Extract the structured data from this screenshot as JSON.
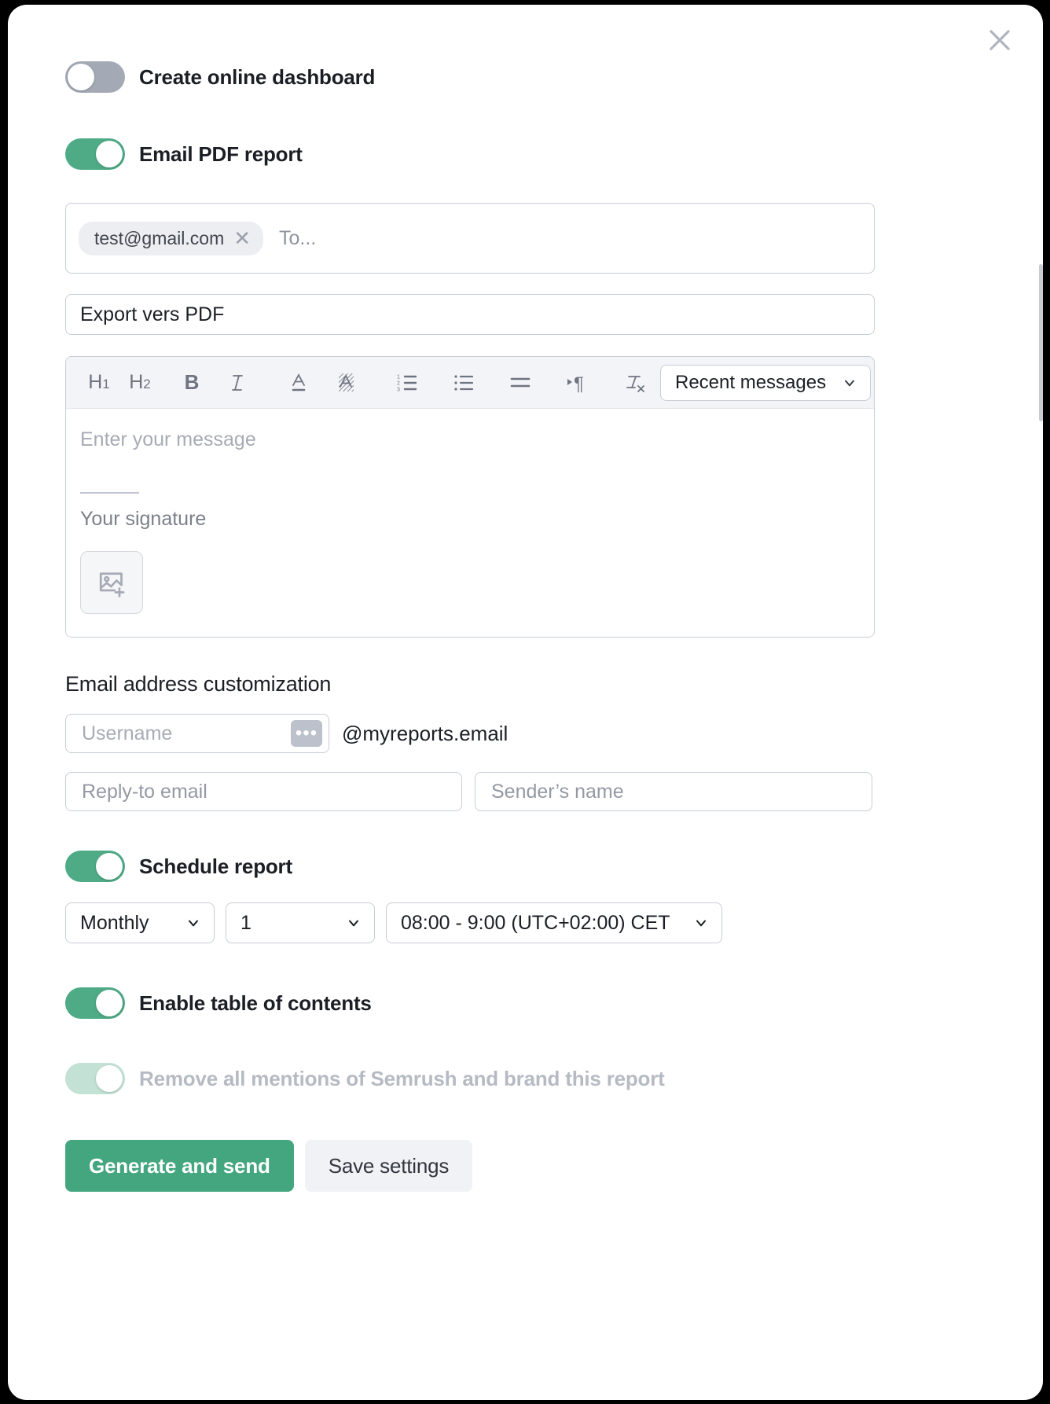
{
  "modal": {
    "close_icon": "close-icon"
  },
  "toggles": {
    "create_dashboard": {
      "label": "Create online dashboard",
      "state": "off"
    },
    "email_pdf": {
      "label": "Email PDF report",
      "state": "on"
    },
    "schedule": {
      "label": "Schedule report",
      "state": "on"
    },
    "toc": {
      "label": "Enable table of contents",
      "state": "on"
    },
    "whitelabel": {
      "label": "Remove all mentions of Semrush and brand this report",
      "state": "on-disabled"
    }
  },
  "recipients": {
    "chips": [
      {
        "email": "test@gmail.com",
        "remove_icon": "close-icon"
      }
    ],
    "placeholder": "To..."
  },
  "subject": {
    "value": "Export vers PDF"
  },
  "editor": {
    "toolbar": [
      {
        "name": "heading-1-icon",
        "glyph": "H₁"
      },
      {
        "name": "heading-2-icon",
        "glyph": "H₂"
      },
      {
        "name": "bold-icon",
        "glyph": "B"
      },
      {
        "name": "italic-icon",
        "glyph": "I"
      },
      {
        "name": "text-color-icon",
        "glyph": "A"
      },
      {
        "name": "highlight-color-icon",
        "glyph": "A"
      },
      {
        "name": "ordered-list-icon",
        "glyph": ""
      },
      {
        "name": "bulleted-list-icon",
        "glyph": ""
      },
      {
        "name": "align-left-icon",
        "glyph": ""
      },
      {
        "name": "indent-icon",
        "glyph": "¶"
      },
      {
        "name": "clear-formatting-icon",
        "glyph": "Tx"
      }
    ],
    "template_select": {
      "value": "Recent messages",
      "caret_icon": "chevron-down-icon"
    },
    "message_placeholder": "Enter your message",
    "signature_text": "Your signature",
    "insert_image_icon": "add-image-icon"
  },
  "email_customization": {
    "title": "Email address customization",
    "username": {
      "placeholder": "Username",
      "value": "",
      "badge": "•••"
    },
    "domain": "@myreports.email",
    "reply_to": {
      "placeholder": "Reply-to email",
      "value": ""
    },
    "sender_name": {
      "placeholder": "Sender’s name",
      "value": ""
    }
  },
  "schedule": {
    "frequency": {
      "value": "Monthly",
      "caret_icon": "chevron-down-icon"
    },
    "day": {
      "value": "1",
      "caret_icon": "chevron-down-icon"
    },
    "time": {
      "value": "08:00 - 9:00 (UTC+02:00) CET",
      "caret_icon": "chevron-down-icon"
    }
  },
  "footer": {
    "primary": "Generate and send",
    "secondary": "Save settings"
  },
  "colors": {
    "accent_green": "#44a67f",
    "toggle_on": "#4eab86",
    "toggle_off": "#a4aab5",
    "toggle_disabled": "#c3e2d5"
  }
}
